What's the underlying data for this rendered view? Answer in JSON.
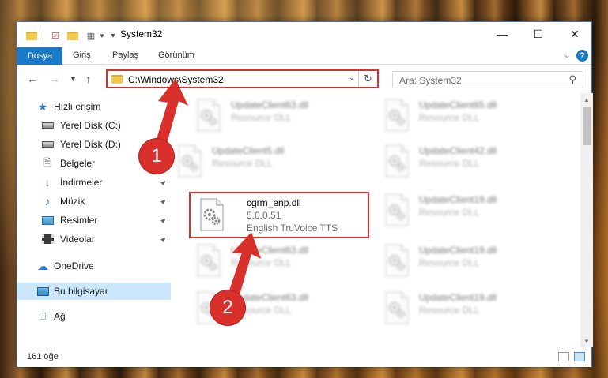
{
  "window": {
    "title": "System32",
    "minimize_icon": "minimize-icon",
    "maximize_icon": "maximize-icon",
    "close_icon": "close-icon"
  },
  "ribbon": {
    "tabs": [
      "Dosya",
      "Giriş",
      "Paylaş",
      "Görünüm"
    ],
    "help": "?"
  },
  "navigation": {
    "address": "C:\\Windows\\System32",
    "search_placeholder": "Ara: System32"
  },
  "sidebar": {
    "items": [
      {
        "label": "Hızlı erişim",
        "icon": "star-icon"
      },
      {
        "label": "Yerel Disk (C:)",
        "icon": "drive-icon"
      },
      {
        "label": "Yerel Disk (D:)",
        "icon": "drive-icon"
      },
      {
        "label": "Belgeler",
        "icon": "documents-icon"
      },
      {
        "label": "İndirmeler",
        "icon": "downloads-icon"
      },
      {
        "label": "Müzik",
        "icon": "music-icon"
      },
      {
        "label": "Resimler",
        "icon": "pictures-icon"
      },
      {
        "label": "Videolar",
        "icon": "videos-icon"
      },
      {
        "label": "OneDrive",
        "icon": "cloud-icon"
      },
      {
        "label": "Bu bilgisayar",
        "icon": "computer-icon"
      },
      {
        "label": "Ağ",
        "icon": "network-icon"
      }
    ]
  },
  "files": [
    {
      "name": "UpdateClient63.dll",
      "desc": "Resource DLL"
    },
    {
      "name": "UpdateClient65.dll",
      "desc": "Resource DLL"
    },
    {
      "name": "UpdateClient5.dll",
      "desc": "Resource DLL"
    },
    {
      "name": "UpdateClient42.dll",
      "desc": "Resource DLL"
    },
    {
      "name": "cgrm_enp.dll",
      "desc": "5.0.0.51",
      "desc2": "English TruVoice TTS"
    },
    {
      "name": "UpdateClient19.dll",
      "desc": "Resource DLL"
    },
    {
      "name": "UpdateClient63.dll",
      "desc": "Resource DLL"
    },
    {
      "name": "UpdateClient19.dll",
      "desc": "Resource DLL"
    },
    {
      "name": "UpdateClient63.dll",
      "desc": "Resource DLL"
    },
    {
      "name": "UpdateClient19.dll",
      "desc": "Resource DLL"
    }
  ],
  "status": {
    "item_count": "161 öğe"
  },
  "annotations": {
    "step1": "1",
    "step2": "2",
    "color": "#d9302c"
  },
  "colors": {
    "accent": "#1979ca",
    "selection": "#cce8ff",
    "highlight": "#d9302c"
  }
}
